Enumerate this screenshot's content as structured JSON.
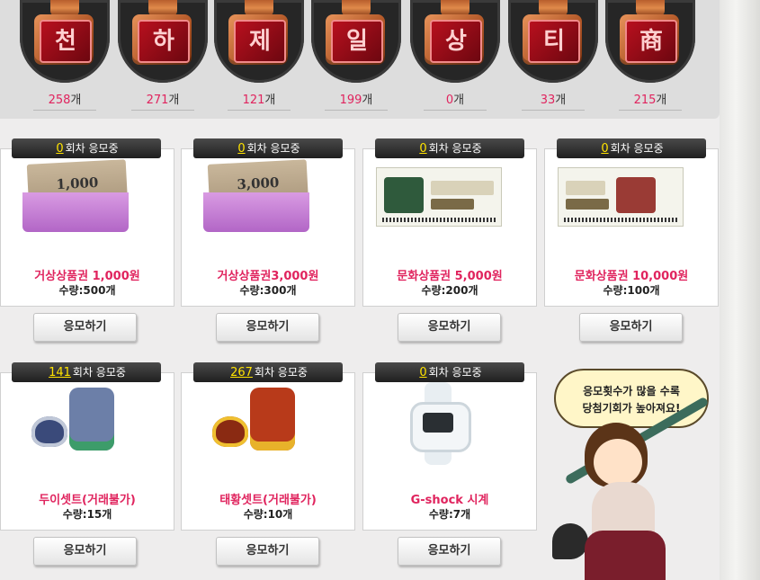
{
  "stamps": [
    {
      "glyph": "천",
      "count": "258",
      "unit": "개"
    },
    {
      "glyph": "하",
      "count": "271",
      "unit": "개"
    },
    {
      "glyph": "제",
      "count": "121",
      "unit": "개"
    },
    {
      "glyph": "일",
      "count": "199",
      "unit": "개"
    },
    {
      "glyph": "상",
      "count": "0",
      "unit": "개"
    },
    {
      "glyph": "티",
      "count": "33",
      "unit": "개"
    },
    {
      "glyph": "商",
      "count": "215",
      "unit": "개"
    }
  ],
  "round_suffix": "회차 응모중",
  "apply_label": "응모하기",
  "items": [
    {
      "round": "0",
      "name": "거상상품권 1,000원",
      "qty": "수량:500개",
      "art_label": "1,000"
    },
    {
      "round": "0",
      "name": "거상상품권3,000원",
      "qty": "수량:300개",
      "art_label": "3,000"
    },
    {
      "round": "0",
      "name": "문화상품권 5,000원",
      "qty": "수량:200개"
    },
    {
      "round": "0",
      "name": "문화상품권 10,000원",
      "qty": "수량:100개"
    },
    {
      "round": "141",
      "name": "두이셋트(거래불가)",
      "qty": "수량:15개"
    },
    {
      "round": "267",
      "name": "태황셋트(거래불가)",
      "qty": "수량:10개"
    },
    {
      "round": "0",
      "name": "G-shock 시계",
      "qty": "수량:7개"
    }
  ],
  "mascot": {
    "line1": "응모횟수가 많을 수록",
    "line2": "당첨기회가 높아져요!"
  },
  "colors": {
    "accent": "#e0245e",
    "round_number": "#ffe300",
    "tab_bg": "#2a2a2a"
  }
}
